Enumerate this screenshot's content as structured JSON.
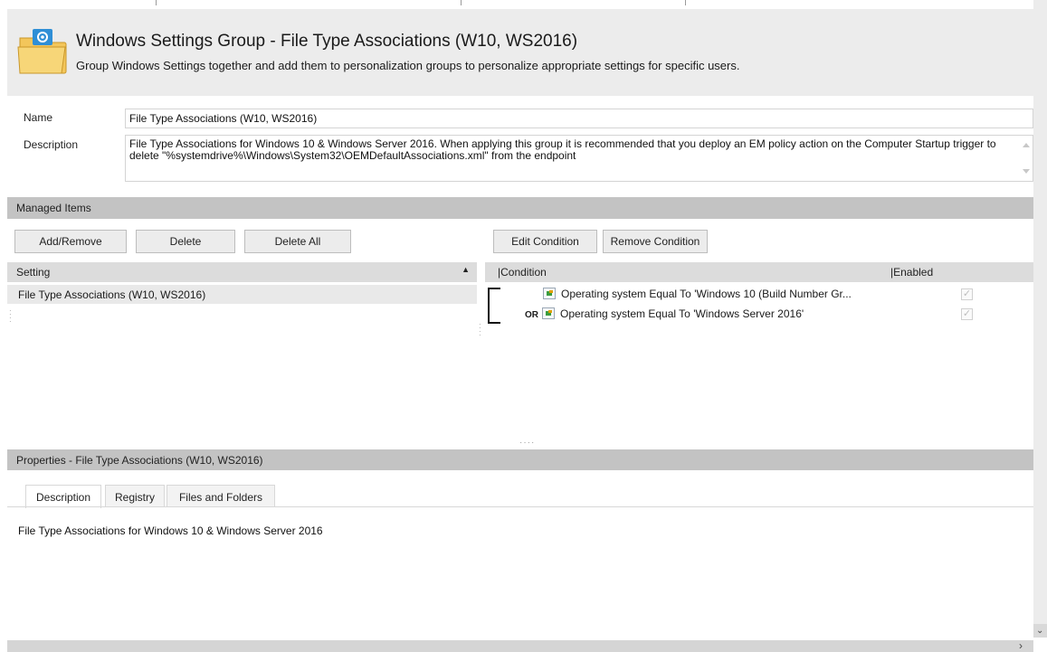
{
  "header": {
    "title": "Windows Settings Group - File Type Associations (W10, WS2016)",
    "subtitle": "Group Windows Settings together and add them to personalization groups to personalize appropriate settings for specific users.",
    "icon": "settings-folder-icon"
  },
  "form": {
    "name_label": "Name",
    "name_value": "File Type Associations (W10, WS2016)",
    "description_label": "Description",
    "description_value": "File Type Associations for Windows 10 & Windows Server 2016. When applying this group it is recommended that you deploy an EM policy action on the Computer Startup trigger to delete \"%systemdrive%\\Windows\\System32\\OEMDefaultAssociations.xml\" from the endpoint"
  },
  "managed_items": {
    "section_title": "Managed Items",
    "buttons": {
      "add_remove": "Add/Remove",
      "delete": "Delete",
      "delete_all": "Delete All",
      "edit_condition": "Edit Condition",
      "remove_condition": "Remove Condition"
    },
    "settings_grid": {
      "column": "Setting",
      "rows": [
        "File Type Associations (W10, WS2016)"
      ]
    },
    "conditions_grid": {
      "columns": {
        "condition": "|Condition",
        "enabled": "|Enabled"
      },
      "rows": [
        {
          "operator": "",
          "text": "Operating system Equal To 'Windows 10 (Build Number Gr...",
          "enabled": true
        },
        {
          "operator": "OR",
          "text": "Operating system Equal To 'Windows Server 2016'",
          "enabled": true
        }
      ]
    }
  },
  "properties": {
    "section_title": "Properties - File Type Associations (W10, WS2016)",
    "tabs": [
      "Description",
      "Registry",
      "Files and Folders"
    ],
    "active_tab": "Description",
    "content": "File Type Associations for Windows 10 & Windows Server 2016"
  },
  "colors": {
    "header_bg": "#ececec",
    "section_bar": "#c3c3c3",
    "grid_header": "#dcdcdc",
    "selected_row": "#e9e9e9"
  }
}
